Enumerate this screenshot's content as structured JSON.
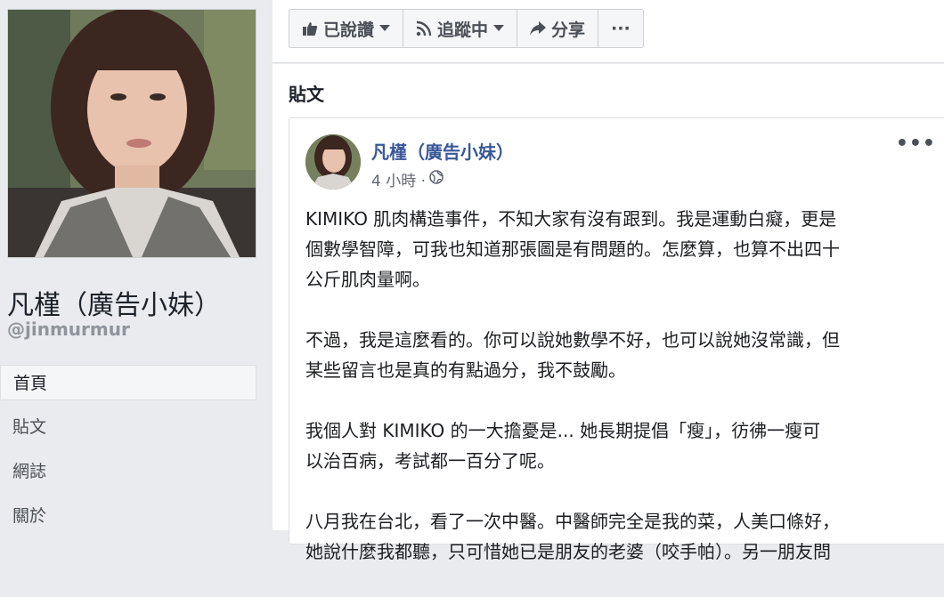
{
  "profile": {
    "name": "凡槿（廣告小妹）",
    "username": "@jinmurmur"
  },
  "left_nav": {
    "items": [
      {
        "label": "首頁",
        "active": true
      },
      {
        "label": "貼文",
        "active": false
      },
      {
        "label": "網誌",
        "active": false
      },
      {
        "label": "關於",
        "active": false
      }
    ]
  },
  "action_bar": {
    "liked_label": "已說讚",
    "following_label": "追蹤中",
    "share_label": "分享",
    "more_label": "···"
  },
  "feed": {
    "heading": "貼文"
  },
  "post": {
    "author": "凡槿（廣告小妹）",
    "time": "4 小時 ·",
    "more": "•••",
    "paragraphs": [
      "KIMIKO 肌肉構造事件，不知大家有沒有跟到。我是運動白癡，更是\n個數學智障，可我也知道那張圖是有問題的。怎麼算，也算不出四十\n公斤肌肉量啊。",
      "不過，我是這麼看的。你可以說她數學不好，也可以說她沒常識，但\n某些留言也是真的有點過分，我不鼓勵。",
      "我個人對 KIMIKO 的一大擔憂是... 她長期提倡「瘦」，彷彿一瘦可\n以治百病，考試都一百分了呢。",
      "八月我在台北，看了一次中醫。中醫師完全是我的菜，人美口條好，\n她說什麼我都聽，只可惜她已是朋友的老婆（咬手帕）。另一朋友問"
    ]
  },
  "colors": {
    "link_blue": "#385898",
    "background": "#e9ebee"
  }
}
